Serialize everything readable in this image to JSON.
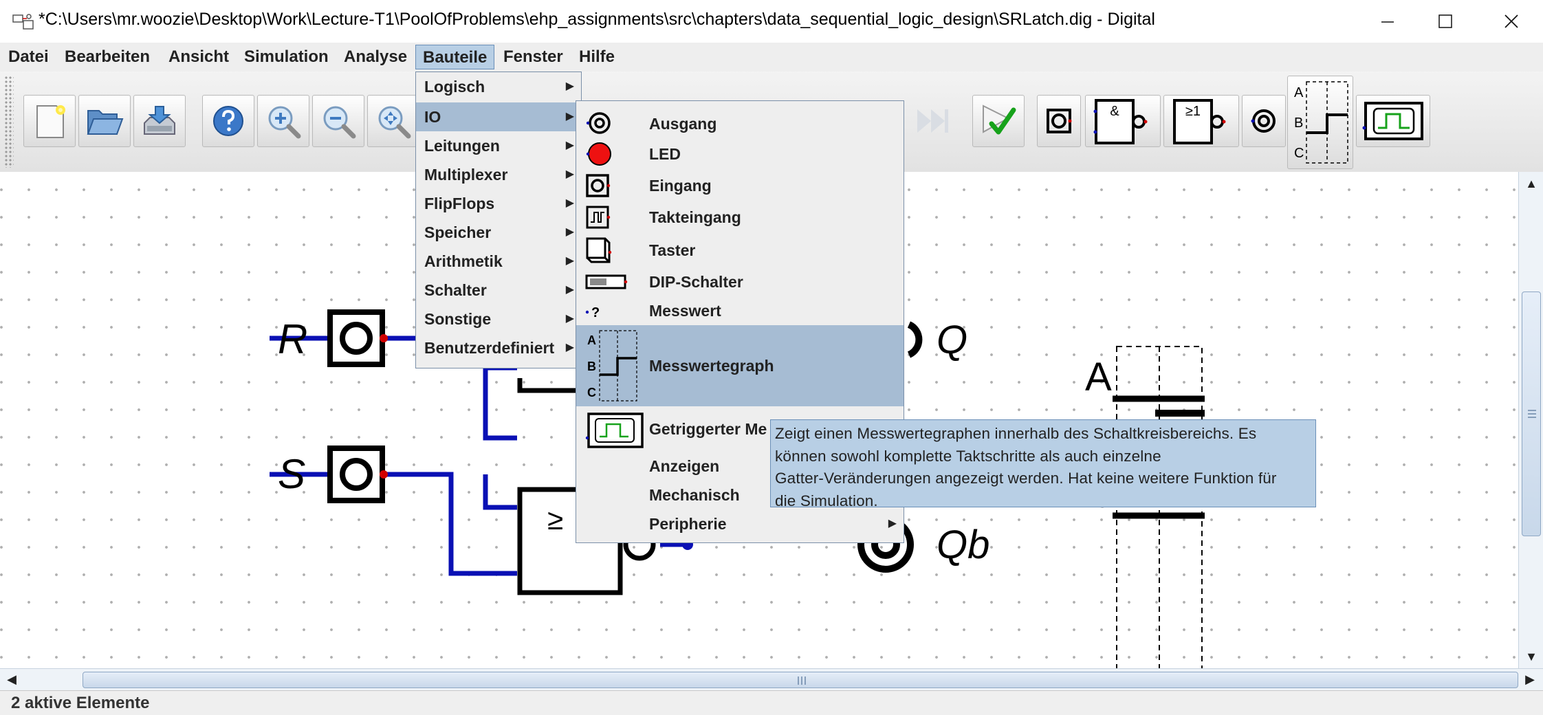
{
  "window": {
    "title": "*C:\\Users\\mr.woozie\\Desktop\\Work\\Lecture-T1\\PoolOfProblems\\ehp_assignments\\src\\chapters\\data_sequential_logic_design\\SRLatch.dig - Digital"
  },
  "menubar": {
    "items": [
      "Datei",
      "Bearbeiten",
      "Ansicht",
      "Simulation",
      "Analyse",
      "Bauteile",
      "Fenster",
      "Hilfe"
    ],
    "active": "Bauteile"
  },
  "bauteile_menu": {
    "items": [
      "Logisch",
      "IO",
      "Leitungen",
      "Multiplexer",
      "FlipFlops",
      "Speicher",
      "Arithmetik",
      "Schalter",
      "Sonstige",
      "Benutzerdefiniert"
    ],
    "selected": "IO"
  },
  "io_menu": {
    "items": [
      "Ausgang",
      "LED",
      "Eingang",
      "Takteingang",
      "Taster",
      "DIP-Schalter",
      "Messwert",
      "Messwertegraph",
      "Getriggerter Me",
      "Anzeigen",
      "Mechanisch",
      "Peripherie"
    ],
    "selected": "Messwertegraph",
    "icon_glyphs": {
      "probe": "?",
      "graph_letters": [
        "A",
        "B",
        "C"
      ]
    }
  },
  "tooltip": {
    "lines": [
      "Zeigt einen Messwertegraphen innerhalb des Schaltkreisbereichs. Es",
      "können sowohl komplette Taktschritte als auch einzelne",
      "Gatter-Veränderungen angezeigt werden. Hat keine weitere Funktion für",
      "die Simulation."
    ]
  },
  "toolbar": {
    "gate_labels": {
      "and": "&",
      "or": "≥1"
    },
    "graph_letters": [
      "A",
      "B",
      "C"
    ]
  },
  "circuit": {
    "inputs": [
      "R",
      "S"
    ],
    "outputs": [
      "Q",
      "Qb"
    ],
    "gate_symbol": "≥",
    "graph_label": "A"
  },
  "status": {
    "text": "2 aktive Elemente"
  },
  "colors": {
    "wire": "#0a10b4",
    "menu_highlight": "#a6bcd3",
    "tooltip_bg": "#b8cfe5",
    "pin": "#d10000"
  }
}
